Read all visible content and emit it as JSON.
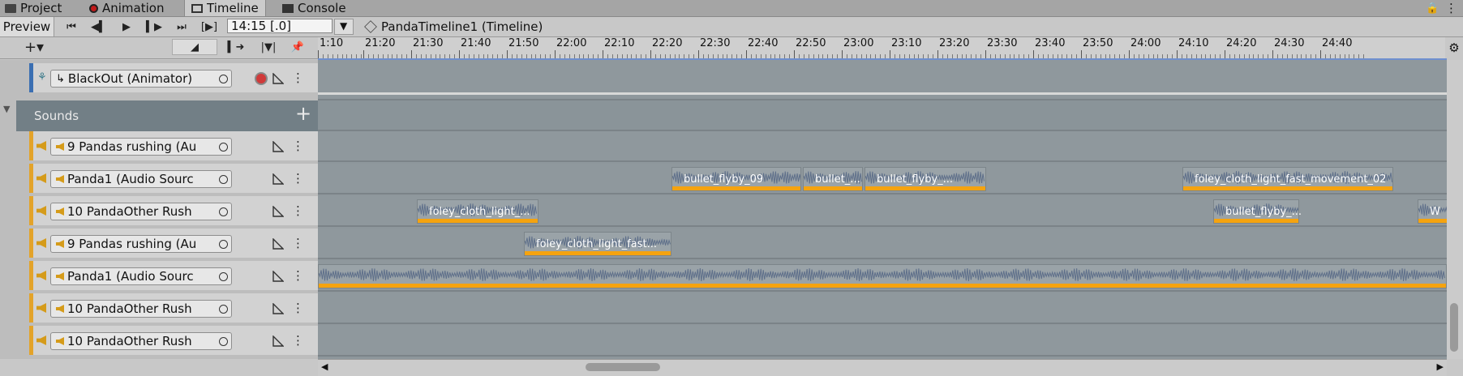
{
  "window_tabs": [
    {
      "label": "Project",
      "icon": "folder-icon"
    },
    {
      "label": "Animation",
      "icon": "record-icon"
    },
    {
      "label": "Timeline",
      "icon": "timeline-icon",
      "active": true
    },
    {
      "label": "Console",
      "icon": "console-icon"
    }
  ],
  "toolbar": {
    "preview_label": "Preview",
    "time_value": "14:15 [.0]",
    "breadcrumb": "PandaTimeline1 (Timeline)"
  },
  "ruler_ticks": [
    "1:10",
    "21:20",
    "21:30",
    "21:40",
    "21:50",
    "22:00",
    "22:10",
    "22:20",
    "22:30",
    "22:40",
    "22:50",
    "23:00",
    "23:10",
    "23:20",
    "23:30",
    "23:40",
    "23:50",
    "24:00",
    "24:10",
    "24:20",
    "24:30",
    "24:40"
  ],
  "tracks": {
    "animator": {
      "label": "BlackOut (Animator)"
    },
    "group": {
      "label": "Sounds"
    },
    "audio": [
      {
        "label": "9 Pandas rushing (Au"
      },
      {
        "label": "Panda1 (Audio Sourc"
      },
      {
        "label": "10 PandaOther Rush"
      },
      {
        "label": "9 Pandas rushing (Au"
      },
      {
        "label": "Panda1 (Audio Sourc"
      },
      {
        "label": "10 PandaOther Rush"
      },
      {
        "label": "10 PandaOther Rush"
      }
    ]
  },
  "clips": {
    "lane2": [
      "bullet_flyby_09",
      "bullet_...",
      "bullet_flyby_...",
      "foley_cloth_light_fast_movement_02"
    ],
    "lane3": [
      "foley_cloth_light_...",
      "bullet_flyby_...",
      "W"
    ],
    "lane4": [
      "foley_cloth_light_fast..."
    ]
  },
  "colors": {
    "accent": "#f5a30f",
    "record": "#c21b1b",
    "clip_bg": "#9aa3a8",
    "lane_bg": "#8f989d"
  }
}
